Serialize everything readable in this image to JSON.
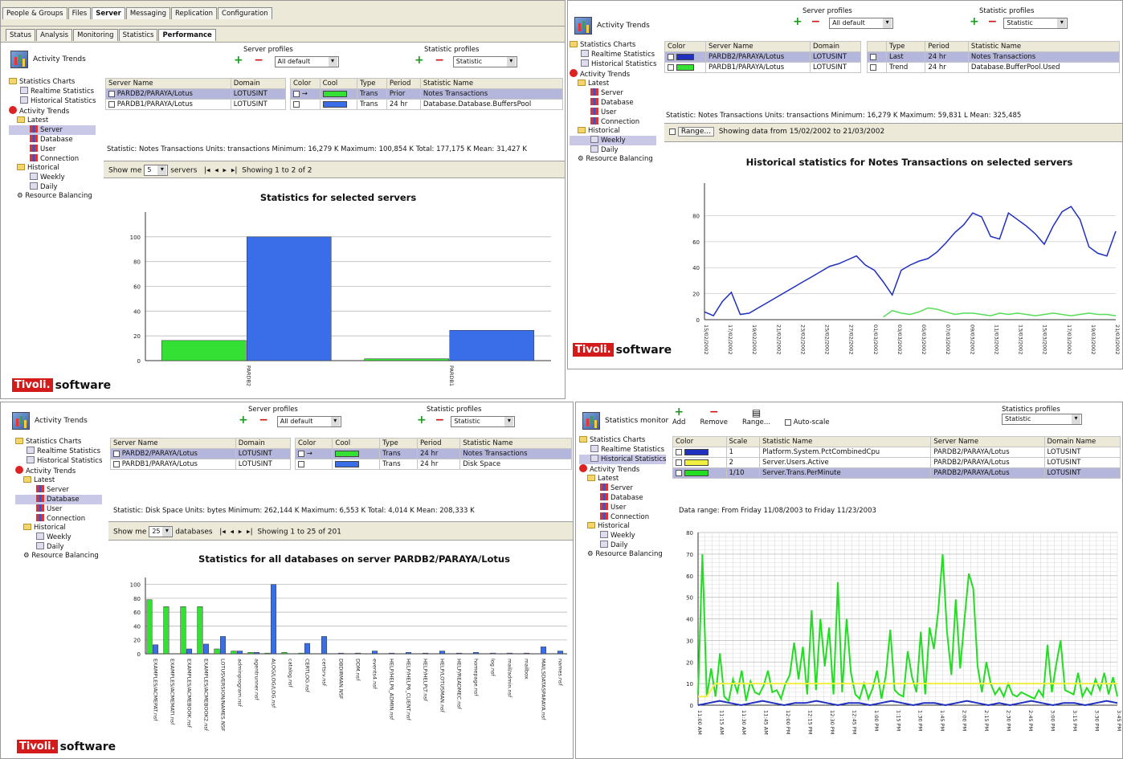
{
  "brand": {
    "tivoli": "Tivoli.",
    "software": "software"
  },
  "app_title": "Activity Trends",
  "tree_common": {
    "root": "Statistics Charts",
    "realtime": "Realtime Statistics",
    "historical_stats": "Historical Statistics",
    "activity": "Activity Trends",
    "latest": "Latest",
    "server": "Server",
    "database": "Database",
    "user": "User",
    "connection": "Connection",
    "historical": "Historical",
    "weekly": "Weekly",
    "daily": "Daily",
    "resource": "Resource Balancing"
  },
  "colors": {
    "green": "#33e033",
    "blue": "#3a6ee8",
    "navy": "#1f2fbf",
    "yellow": "#f0f040",
    "lime": "#22dd22"
  },
  "q1": {
    "menu_tabs": [
      "People & Groups",
      "Files",
      "Server",
      "Messaging",
      "Replication",
      "Configuration"
    ],
    "sub_tabs": [
      "Status",
      "Analysis",
      "Monitoring",
      "Statistics",
      "Performance"
    ],
    "server_profiles": "Server profiles",
    "statistic_profiles": "Statistic profiles",
    "select_server": "All default",
    "select_stat": "Statistic",
    "servers_cols": [
      "Server Name",
      "Domain"
    ],
    "servers": [
      [
        "PARDB2/PARAYA/Lotus",
        "LOTUSINT"
      ],
      [
        "PARDB1/PARAYA/Lotus",
        "LOTUSINT"
      ]
    ],
    "stats_cols": [
      "Color",
      "Cool",
      "Type",
      "Period",
      "Statistic Name"
    ],
    "stats": [
      [
        "Trans",
        "Prior",
        "Notes Transactions"
      ],
      [
        "Trans",
        "24 hr",
        "Database.Database.BuffersPool"
      ]
    ],
    "statline": "Statistic: Notes Transactions    Units: transactions    Minimum: 16,279 K    Maximum: 100,854 K    Total: 177,175 K    Mean: 31,427 K",
    "paging": {
      "show": "Show me",
      "count": "5",
      "unit": "servers",
      "showing": "Showing 1 to 2 of 2"
    },
    "chart_title": "Statistics for selected servers"
  },
  "q2": {
    "server_profiles": "Server profiles",
    "statistic_profiles": "Statistic profiles",
    "select_server": "All default",
    "select_stat": "Statistic",
    "servers_cols": [
      "Color",
      "Server Name",
      "Domain"
    ],
    "servers": [
      [
        "PARDB2/PARAYA/Lotus",
        "LOTUSINT"
      ],
      [
        "PARDB1/PARAYA/Lotus",
        "LOTUSINT"
      ]
    ],
    "stats_cols": [
      "Type",
      "Period",
      "Statistic Name"
    ],
    "stats": [
      [
        "Last",
        "24 hr",
        "Notes Transactions"
      ],
      [
        "Trend",
        "24 hr",
        "Database.BufferPool.Used"
      ]
    ],
    "statline": "Statistic: Notes Transactions    Units: transactions    Minimum: 16,279 K    Maximum: 59,831 L    Mean: 325,485",
    "range_btn": "Range...",
    "range_text": "Showing data from 15/02/2002 to 21/03/2002",
    "chart_title": "Historical statistics for Notes Transactions on selected servers"
  },
  "q3": {
    "server_profiles": "Server profiles",
    "statistic_profiles": "Statistic profiles",
    "select_server": "All default",
    "select_stat": "Statistic",
    "servers_cols": [
      "Server Name",
      "Domain"
    ],
    "servers": [
      [
        "PARDB2/PARAYA/Lotus",
        "LOTUSINT"
      ],
      [
        "PARDB1/PARAYA/Lotus",
        "LOTUSINT"
      ]
    ],
    "stats_cols": [
      "Color",
      "Cool",
      "Type",
      "Period",
      "Statistic Name"
    ],
    "stats": [
      [
        "Trans",
        "24 hr",
        "Notes Transactions"
      ],
      [
        "Trans",
        "24 hr",
        "Disk Space"
      ]
    ],
    "statline": "Statistic: Disk Space    Units: bytes    Minimum: 262,144 K    Maximum: 6,553 K    Total: 4,014 K    Mean: 208,333 K",
    "paging": {
      "show": "Show me",
      "count": "25",
      "unit": "databases",
      "showing": "Showing 1 to 25 of 201"
    },
    "chart_title": "Statistics for all databases on server PARDB2/PARAYA/Lotus"
  },
  "q4": {
    "title": "Statistics monitor",
    "toolbar": {
      "add": "Add",
      "remove": "Remove",
      "range": "Range...",
      "autoscale": "Auto-scale"
    },
    "profile_label": "Statistics profiles",
    "profile_value": "Statistic",
    "cols": [
      "Color",
      "Scale",
      "Statistic Name",
      "Server Name",
      "Domain Name"
    ],
    "rows": [
      [
        "1",
        "Platform.System.PctCombinedCpu",
        "PARDB2/PARAYA/Lotus",
        "LOTUSINT"
      ],
      [
        "2",
        "Server.Users.Active",
        "PARDB2/PARAYA/Lotus",
        "LOTUSINT"
      ],
      [
        "1/10",
        "Server.Trans.PerMinute",
        "PARDB2/PARAYA/Lotus",
        "LOTUSINT"
      ]
    ],
    "range_text": "Data range: From Friday 11/08/2003 to Friday 11/23/2003"
  },
  "chart_data": [
    {
      "type": "bar",
      "title": "Statistics for selected servers",
      "categories": [
        "PARDB2",
        "PARDB1"
      ],
      "series": [
        {
          "name": "",
          "color": "#33e033",
          "values": [
            16.3,
            1.5
          ]
        },
        {
          "name": "",
          "color": "#3a6ee8",
          "values": [
            100,
            24.5
          ]
        }
      ],
      "ylim": [
        0,
        120
      ],
      "yticks": [
        0,
        20,
        40,
        60,
        80,
        100
      ],
      "ytick_labels": [
        "0",
        "20",
        "40",
        "60",
        "80",
        "100"
      ]
    },
    {
      "type": "line",
      "title": "Historical statistics for Notes Transactions on selected servers",
      "ylim": [
        0,
        105
      ],
      "yticks": [
        0,
        20,
        40,
        60,
        80
      ],
      "ytick_labels": [
        "0",
        "20",
        "40",
        "60",
        "80"
      ],
      "x": [
        "15/02/2002",
        "17/02/2002",
        "19/02/2002",
        "21/02/2002",
        "23/02/2002",
        "25/02/2002",
        "27/02/2002",
        "01/03/2002",
        "03/03/2002",
        "05/03/2002",
        "07/03/2002",
        "09/03/2002",
        "11/03/2002",
        "13/03/2002",
        "15/03/2002",
        "17/03/2002",
        "19/03/2002",
        "21/03/2002"
      ],
      "series": [
        {
          "name": "PARDB2",
          "color": "#1f2fbf",
          "values": [
            6,
            3,
            14,
            21,
            4,
            5,
            9,
            13,
            17,
            21,
            25,
            29,
            33,
            37,
            41,
            43,
            46,
            49,
            42,
            38,
            29,
            19,
            38,
            42,
            45,
            47,
            52,
            59,
            67,
            73,
            82,
            79,
            64,
            62,
            82,
            77,
            72,
            66,
            58,
            72,
            83,
            87,
            77,
            56,
            51,
            49,
            68
          ]
        },
        {
          "name": "PARDB1",
          "color": "#55dd55",
          "values": [
            null,
            null,
            null,
            null,
            null,
            null,
            null,
            null,
            null,
            null,
            null,
            null,
            null,
            null,
            null,
            null,
            null,
            null,
            null,
            null,
            2,
            7,
            5,
            4,
            6,
            9,
            8,
            6,
            4,
            5,
            5,
            4,
            3,
            5,
            4,
            5,
            4,
            3,
            4,
            5,
            4,
            3,
            4,
            5,
            4,
            4,
            3
          ]
        }
      ]
    },
    {
      "type": "bar",
      "title": "Statistics for all databases on server PARDB2/PARAYA/Lotus",
      "ylim": [
        0,
        110
      ],
      "yticks": [
        0,
        20,
        40,
        60,
        80,
        100
      ],
      "ytick_labels": [
        "0",
        "20",
        "40",
        "60",
        "80",
        "100"
      ],
      "categories": [
        "EXAMPLES/ACMEPAT.nsf",
        "EXAMPLES/ACMEMATI.nsf",
        "EXAMPLES/ACMEBOOK.nsf",
        "EXAMPLES/ACMEBOOK2.nsf",
        "LOTUSVERSION/NAMES.NSF",
        "adminprogram.nsf",
        "agentrunner.nsf",
        "ALOG/LOG/LOG.nsf",
        "catalog.nsf",
        "CERTLOG.nsf",
        "certsrv.nsf",
        "DBDIRMAN.NSF",
        "DDM.nsf",
        "events4.nsf",
        "HELP/HELP6_ADMIN.nsf",
        "HELP/HELP6_CLIENT.nsf",
        "HELP/HELPLT.nsf",
        "HELP/LOTUSMAN.nsf",
        "HELP/READMEC.nsf",
        "homepage.nsf",
        "log.nsf",
        "mail/admin.nsf",
        "mailbox",
        "MAILSDATASPARAYA.nsf",
        "names.nsf"
      ],
      "series": [
        {
          "name": "",
          "color": "#33e033",
          "values": [
            78,
            68,
            68,
            68,
            7,
            4,
            2,
            1,
            2,
            1,
            0,
            0,
            0,
            0,
            0,
            0,
            0,
            0,
            0,
            0,
            0,
            0,
            0,
            0,
            0
          ]
        },
        {
          "name": "",
          "color": "#3a6ee8",
          "values": [
            13,
            0,
            7,
            14,
            25,
            4,
            2,
            100,
            0,
            15,
            25,
            1,
            1,
            4,
            1,
            2,
            1,
            4,
            1,
            2,
            1,
            1,
            1,
            10,
            4
          ]
        }
      ]
    },
    {
      "type": "line",
      "title": "",
      "ylim": [
        0,
        80
      ],
      "yticks": [
        0,
        10,
        20,
        30,
        40,
        50,
        60,
        70,
        80
      ],
      "ytick_labels": [
        "0",
        "10",
        "20",
        "30",
        "40",
        "50",
        "60",
        "70",
        "80"
      ],
      "x": [
        "11:00 AM",
        "11:15 AM",
        "11:30 AM",
        "11:45 AM",
        "12:00 PM",
        "12:15 PM",
        "12:30 PM",
        "12:45 PM",
        "1:00 PM",
        "1:15 PM",
        "1:30 PM",
        "1:45 PM",
        "2:00 PM",
        "2:15 PM",
        "2:30 PM",
        "2:45 PM",
        "3:00 PM",
        "3:15 PM",
        "3:30 PM",
        "3:45 PM"
      ],
      "series": [
        {
          "name": "Server.Trans.PerMinute",
          "color": "#22dd22",
          "values": [
            5,
            70,
            4,
            17,
            4,
            24,
            4,
            2,
            12,
            6,
            16,
            2,
            11,
            6,
            5,
            9,
            16,
            6,
            7,
            3,
            10,
            14,
            29,
            12,
            27,
            5,
            44,
            7,
            40,
            18,
            36,
            5,
            57,
            6,
            40,
            15,
            5,
            3,
            10,
            3,
            8,
            16,
            3,
            14,
            35,
            7,
            5,
            4,
            25,
            13,
            6,
            34,
            5,
            36,
            26,
            44,
            70,
            34,
            14,
            49,
            17,
            40,
            61,
            54,
            18,
            6,
            20,
            10,
            5,
            8,
            4,
            10,
            5,
            4,
            6,
            5,
            4,
            3,
            7,
            4,
            28,
            6,
            19,
            30,
            7,
            6,
            5,
            15,
            4,
            8,
            5,
            12,
            7,
            15,
            5,
            13,
            4
          ]
        },
        {
          "name": "Server.Users.Active",
          "color": "#f0f040",
          "values": [
            4,
            4,
            10,
            10,
            10,
            10,
            10,
            10,
            10,
            10,
            10,
            10,
            10,
            10,
            10,
            10,
            10,
            10,
            10,
            10,
            10,
            10,
            10,
            10,
            10,
            10,
            10,
            10,
            10,
            10,
            10,
            10,
            10,
            10,
            10,
            10,
            10,
            10,
            10,
            10,
            10,
            10,
            10,
            10,
            10,
            10,
            10,
            10,
            10,
            10
          ]
        },
        {
          "name": "Platform.System.PctCombinedCpu",
          "color": "#1f2fbf",
          "values": [
            0,
            1,
            2,
            1,
            0,
            1,
            2,
            1,
            0,
            1,
            1,
            2,
            1,
            0,
            1,
            1,
            0,
            1,
            2,
            1,
            0,
            1,
            1,
            0,
            1,
            2,
            1,
            0,
            1,
            0,
            1,
            2,
            1,
            0,
            1,
            1,
            0,
            1,
            2,
            1
          ]
        }
      ]
    }
  ]
}
